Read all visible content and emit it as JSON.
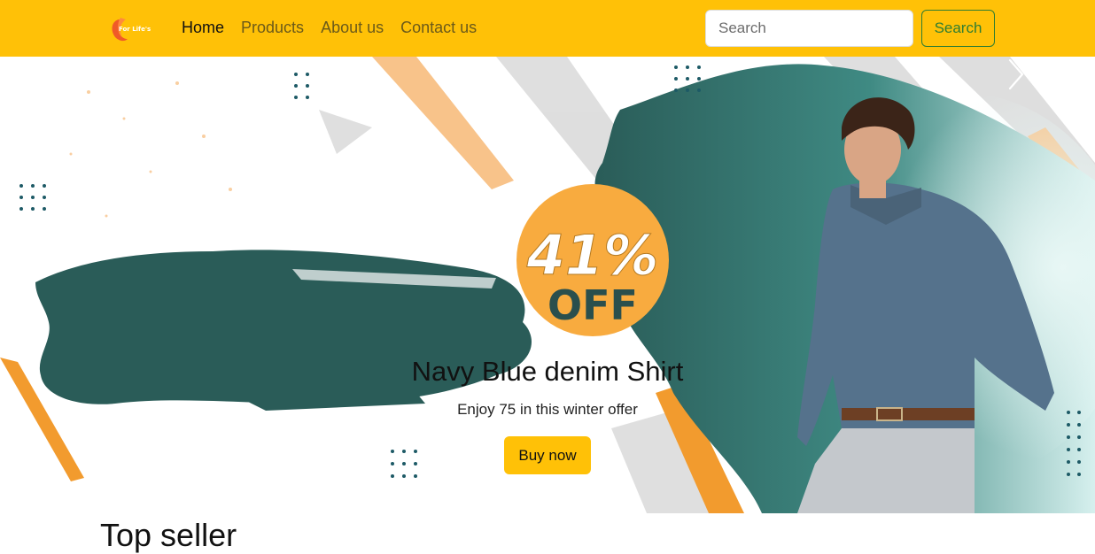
{
  "navbar": {
    "brand_text": "For Life's",
    "links": [
      {
        "label": "Home",
        "active": true
      },
      {
        "label": "Products",
        "active": false
      },
      {
        "label": "About us",
        "active": false
      },
      {
        "label": "Contact us",
        "active": false
      }
    ],
    "search": {
      "placeholder": "Search",
      "button_label": "Search"
    },
    "accent_color": "#ffc107"
  },
  "hero": {
    "badge_percent": "41%",
    "badge_off": "OFF",
    "title": "Navy Blue denim Shirt",
    "subtitle": "Enjoy 75 in this winter offer",
    "button_label": "Buy now",
    "prev_icon": "chevron-left-icon",
    "next_icon": "chevron-right-icon",
    "colors": {
      "teal": "#2a5c58",
      "orange": "#f7a53d",
      "badge": "#f8ab3f"
    }
  },
  "sections": {
    "top_seller_title": "Top seller"
  }
}
